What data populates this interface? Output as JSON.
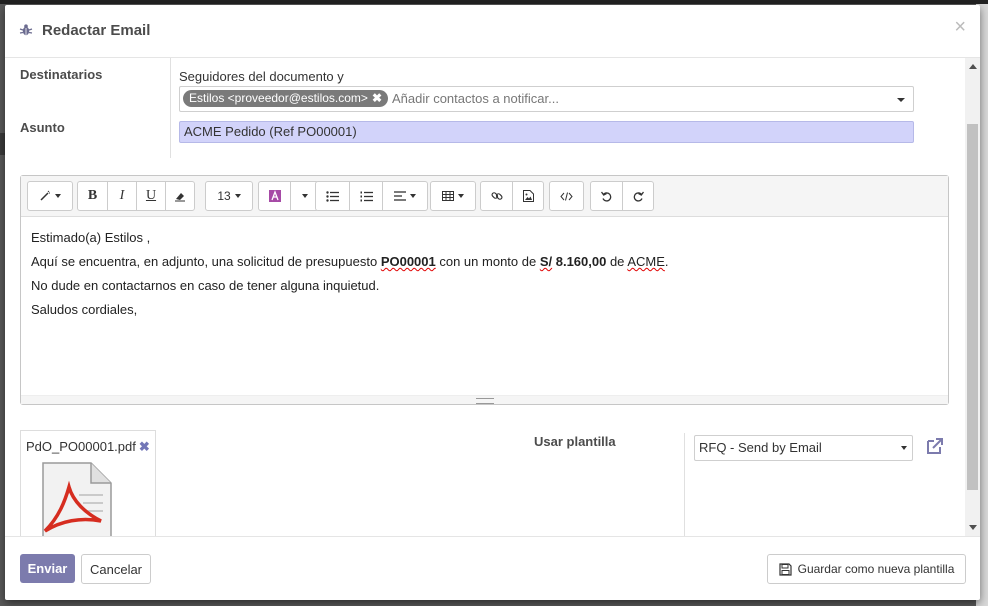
{
  "dialog": {
    "title": "Redactar Email",
    "close_glyph": "×"
  },
  "recipients": {
    "label": "Destinatarios",
    "followers_text": "Seguidores del documento y",
    "tags": [
      {
        "label": "Estilos <proveedor@estilos.com>",
        "remove_glyph": "✖"
      }
    ],
    "placeholder": "Añadir contactos a notificar..."
  },
  "subject": {
    "label": "Asunto",
    "value": "ACME Pedido (Ref PO00001)"
  },
  "toolbar": {
    "font_size": "13",
    "bold": "B",
    "italic": "I",
    "underline": "U",
    "icons": [
      "magic-wand-icon",
      "bold-icon",
      "italic-icon",
      "underline-icon",
      "eraser-icon",
      "font-color-icon",
      "unordered-list-icon",
      "ordered-list-icon",
      "align-icon",
      "table-icon",
      "link-icon",
      "image-icon",
      "code-view-icon",
      "undo-icon",
      "redo-icon"
    ]
  },
  "body": {
    "greeting": "Estimado(a) Estilos ,",
    "line1_pre": "Aquí se encuentra, en adjunto, una solicitud de presupuesto ",
    "line1_ref": "PO00001",
    "line1_mid": " con un monto de ",
    "line1_amount_currency": "S/",
    "line1_amount_value": " 8.160,00",
    "line1_de": " de ",
    "line1_company": "ACME",
    "line1_end": ".",
    "line2": "No dude en contactarnos en caso de tener alguna inquietud.",
    "closing": "Saludos cordiales,"
  },
  "attachment": {
    "filename": "PdO_PO00001.pdf",
    "remove_glyph": "✖",
    "icon": "pdf-file-icon"
  },
  "template": {
    "label": "Usar plantilla",
    "selected": "RFQ - Send by Email"
  },
  "footer": {
    "send": "Enviar",
    "cancel": "Cancelar",
    "save_template": "Guardar como nueva plantilla"
  },
  "colors": {
    "primary": "#7c7bad",
    "subject_bg": "#d2d3fa",
    "tag_bg": "#7a7a7a"
  }
}
